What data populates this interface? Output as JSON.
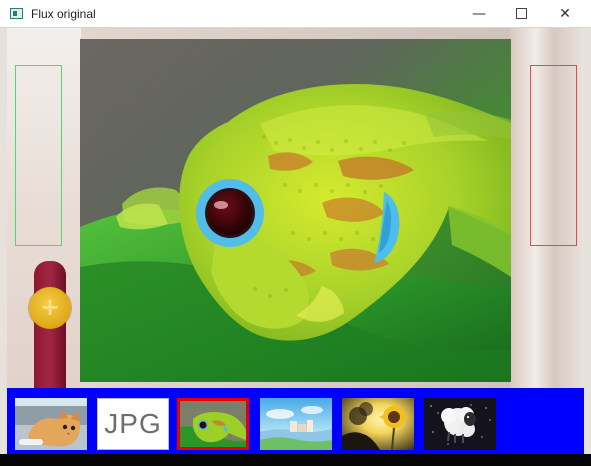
{
  "window": {
    "title": "Flux original",
    "minimize_symbol": "—",
    "close_symbol": "✕"
  },
  "icons": {
    "app": "window-icon",
    "minimize": "minimize-icon",
    "maximize": "maximize-icon",
    "close": "close-icon",
    "add": "plus-icon"
  },
  "viewer": {
    "add_symbol": "+",
    "main_image": "green-gecko-closeup"
  },
  "thumbnails": [
    {
      "name": "thumbnail-kitten",
      "label": ""
    },
    {
      "name": "thumbnail-jpg-icon",
      "label": "JPG"
    },
    {
      "name": "thumbnail-gecko",
      "label": "",
      "selected": true
    },
    {
      "name": "thumbnail-sky-town",
      "label": ""
    },
    {
      "name": "thumbnail-sunflower",
      "label": ""
    },
    {
      "name": "thumbnail-sheep",
      "label": ""
    }
  ],
  "colors": {
    "thumbbar_background": "#0000ff",
    "selection_border": "#e50000",
    "prev_zone_border": "#4ddc61",
    "next_zone_border": "#e34a4a",
    "add_button": "#dfa717"
  }
}
